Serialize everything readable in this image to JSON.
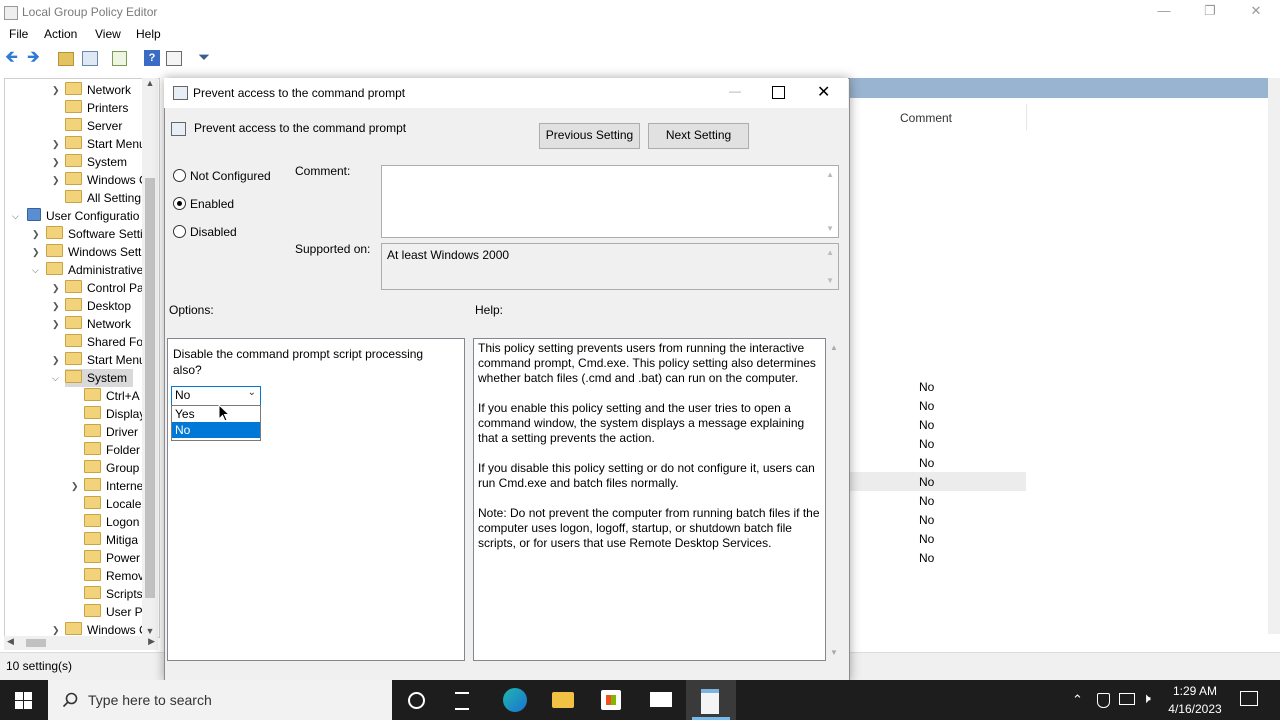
{
  "window": {
    "title": "Local Group Policy Editor"
  },
  "menu": [
    "File",
    "Action",
    "View",
    "Help"
  ],
  "tree": {
    "items": [
      {
        "label": "Network",
        "y": 0
      },
      {
        "label": "Printers",
        "y": 1
      },
      {
        "label": "Server",
        "y": 2
      },
      {
        "label": "Start Menu",
        "y": 3
      },
      {
        "label": "System",
        "y": 4
      },
      {
        "label": "Windows C",
        "y": 5
      },
      {
        "label": "All Setting",
        "y": 6
      },
      {
        "label": "User Configuratio",
        "y": 7
      },
      {
        "label": "Software Setti",
        "y": 8
      },
      {
        "label": "Windows Sett",
        "y": 9
      },
      {
        "label": "Administrative",
        "y": 10
      },
      {
        "label": "Control Pa",
        "y": 11
      },
      {
        "label": "Desktop",
        "y": 12
      },
      {
        "label": "Network",
        "y": 13
      },
      {
        "label": "Shared Fol",
        "y": 14
      },
      {
        "label": "Start Menu",
        "y": 15
      },
      {
        "label": "System",
        "y": 16
      },
      {
        "label": "Ctrl+A",
        "y": 17
      },
      {
        "label": "Display",
        "y": 18
      },
      {
        "label": "Driver",
        "y": 19
      },
      {
        "label": "Folder",
        "y": 20
      },
      {
        "label": "Group",
        "y": 21
      },
      {
        "label": "Interne",
        "y": 22
      },
      {
        "label": "Locale",
        "y": 23
      },
      {
        "label": "Logon",
        "y": 24
      },
      {
        "label": "Mitiga",
        "y": 25
      },
      {
        "label": "Power",
        "y": 26
      },
      {
        "label": "Remov",
        "y": 27
      },
      {
        "label": "Scripts",
        "y": 28
      },
      {
        "label": "User Pr",
        "y": 29
      },
      {
        "label": "Windows C",
        "y": 30
      }
    ]
  },
  "status": {
    "text": "10 setting(s)"
  },
  "right_pane": {
    "column_comment": "Comment",
    "states": [
      "No",
      "No",
      "No",
      "No",
      "No",
      "No",
      "No",
      "No",
      "No",
      "No"
    ]
  },
  "dialog": {
    "title": "Prevent access to the command prompt",
    "header": "Prevent access to the command prompt",
    "previous_setting": "Previous Setting",
    "next_setting": "Next Setting",
    "not_configured": "Not Configured",
    "enabled": "Enabled",
    "disabled": "Disabled",
    "comment_label": "Comment:",
    "supported_on_label": "Supported on:",
    "supported_on_value": "At least Windows 2000",
    "options_label": "Options:",
    "help_label": "Help:",
    "option_question": "Disable the command prompt script processing also?",
    "select_value": "No",
    "select_options": [
      "Yes",
      "No"
    ],
    "help_paragraphs": [
      "This policy setting prevents users from running the interactive command prompt, Cmd.exe.  This policy setting also determines whether batch files (.cmd and .bat) can run on the computer.",
      "If you enable this policy setting and the user tries to open a command window, the system displays a message explaining that a setting prevents the action.",
      "If you disable this policy setting or do not configure it, users can run Cmd.exe and batch files normally.",
      "Note: Do not prevent the computer from running batch files if the computer uses logon, logoff, startup, or shutdown batch file scripts, or for users that use Remote Desktop Services."
    ]
  },
  "taskbar": {
    "search_placeholder": "Type here to search",
    "time": "1:29 AM",
    "date": "4/16/2023"
  }
}
